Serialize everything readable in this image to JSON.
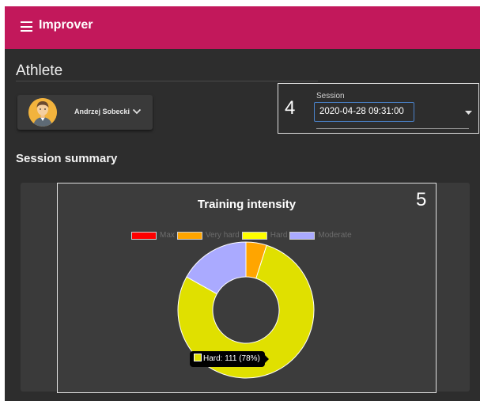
{
  "app": {
    "title": "Improver"
  },
  "athlete_section": {
    "title": "Athlete",
    "name": "Andrzej Sobecki"
  },
  "session_section": {
    "marker": "4",
    "label": "Session",
    "value": "2020-04-28 09:31:00"
  },
  "summary": {
    "title": "Session summary"
  },
  "chart_marker": "5",
  "chart_data": {
    "type": "pie",
    "title": "Training intensity",
    "legend": [
      {
        "label": "Max",
        "color": "#ff0000"
      },
      {
        "label": "Very hard",
        "color": "#ffa500"
      },
      {
        "label": "Hard",
        "color": "#ffff00"
      },
      {
        "label": "Moderate",
        "color": "#aaaaff"
      }
    ],
    "slices": [
      {
        "label": "Max",
        "value": 0,
        "color": "#ff0000"
      },
      {
        "label": "Very hard",
        "value": 7,
        "color": "#ffa500"
      },
      {
        "label": "Hard",
        "value": 111,
        "color": "#e0e000"
      },
      {
        "label": "Moderate",
        "value": 24,
        "color": "#aaaaff"
      }
    ],
    "legend_position": "top"
  },
  "tooltip": {
    "text": "Hard: 111 (78%)",
    "color": "#e0e000"
  }
}
